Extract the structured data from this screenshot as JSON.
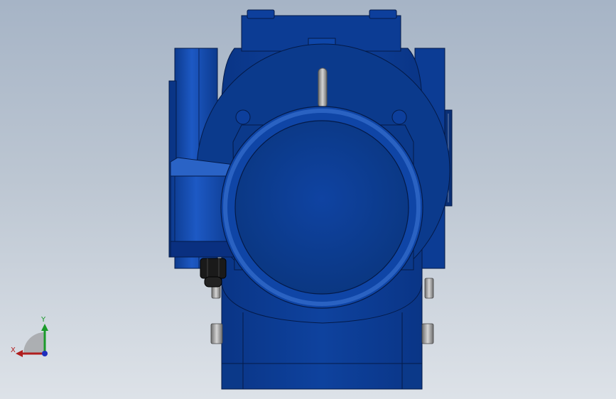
{
  "viewport": {
    "background_top": "#a6b4c6",
    "background_bottom": "#dde2e8"
  },
  "model": {
    "body_color": "#0d3c94",
    "body_dark": "#082a6e",
    "edge_color": "#041a48",
    "highlight_color": "#2f66c8",
    "metal_color": "#9a9a9a"
  },
  "triad": {
    "x_label": "X",
    "y_label": "Y",
    "x_color": "#b01e1e",
    "y_color": "#1a9a2a",
    "z_color": "#1e2ebd"
  }
}
